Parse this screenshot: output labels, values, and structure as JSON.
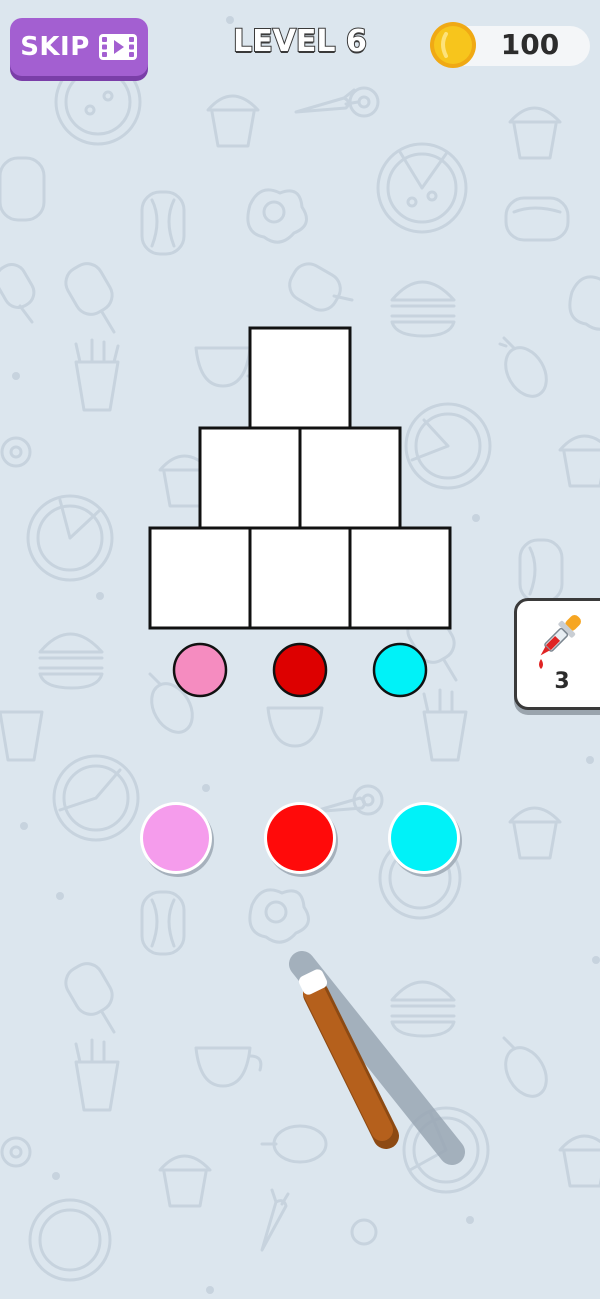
{
  "header": {
    "skip_label": "SKIP",
    "level_title": "LEVEL 6",
    "coins": "100"
  },
  "puzzle": {
    "rows": [
      {
        "blocks": 1,
        "fill": [
          "#ffffff"
        ]
      },
      {
        "blocks": 2,
        "fill": [
          "#ffffff",
          "#ffffff"
        ]
      },
      {
        "blocks": 3,
        "fill": [
          "#ffffff",
          "#ffffff",
          "#ffffff"
        ]
      }
    ],
    "target_colors": [
      "#f58cc0",
      "#dd0000",
      "#00f2f8"
    ]
  },
  "palette": {
    "colors": [
      "#f59cec",
      "#ff0a0a",
      "#00f2f8"
    ]
  },
  "hint": {
    "count": "3",
    "icon": "dropper-icon"
  },
  "colors": {
    "background": "#dce6ee",
    "skip_button": "#a35fd1",
    "coin": "#f7c51c",
    "brush_handle": "#b5601c"
  }
}
